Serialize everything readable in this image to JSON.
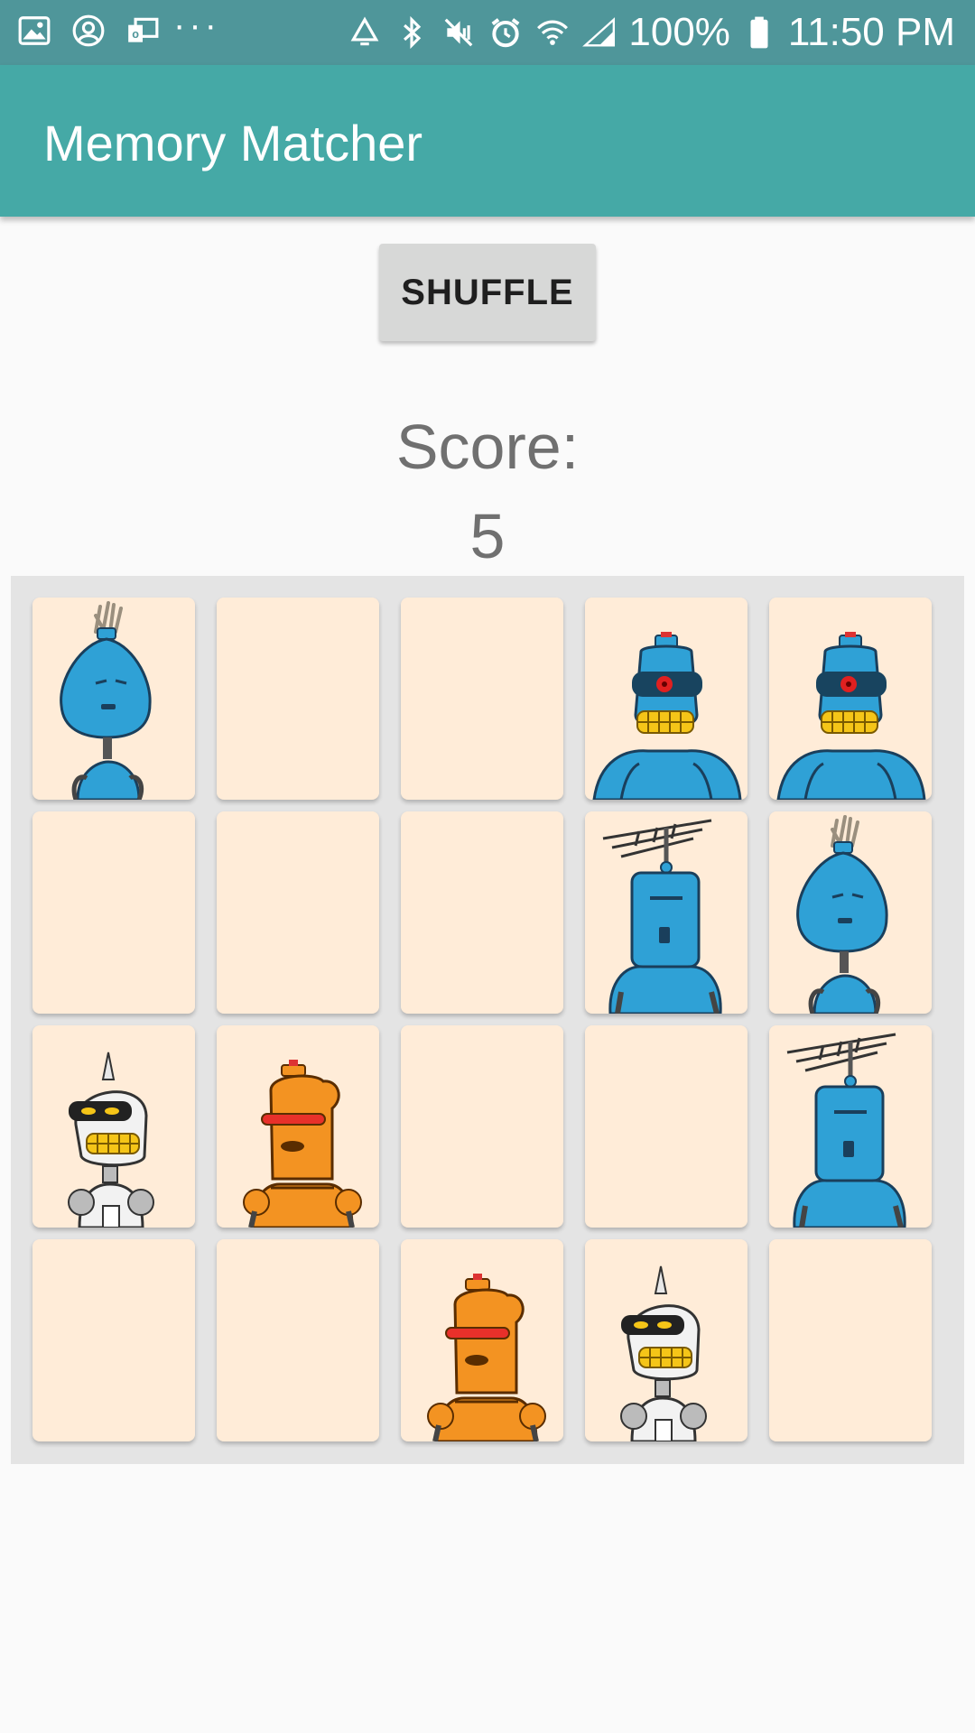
{
  "status_bar": {
    "battery": "100%",
    "time": "11:50 PM",
    "left_icons": [
      "gallery-icon",
      "account-icon",
      "email-icon",
      "more-dots-icon"
    ],
    "right_icons": [
      "recycle-icon",
      "bluetooth-icon",
      "mute-icon",
      "alarm-icon",
      "wifi-icon",
      "signal-icon",
      "battery-icon"
    ]
  },
  "app_bar": {
    "title": "Memory Matcher"
  },
  "controls": {
    "shuffle_label": "SHUFFLE"
  },
  "score": {
    "label": "Score:",
    "value": "5"
  },
  "board": {
    "rows": 4,
    "columns": 5,
    "cards": [
      {
        "face": "robot-hair"
      },
      {
        "face": "blank"
      },
      {
        "face": "blank"
      },
      {
        "face": "robot-cyclops"
      },
      {
        "face": "robot-cyclops"
      },
      {
        "face": "blank"
      },
      {
        "face": "blank"
      },
      {
        "face": "blank"
      },
      {
        "face": "robot-antenna"
      },
      {
        "face": "robot-hair"
      },
      {
        "face": "robot-silver"
      },
      {
        "face": "robot-orange"
      },
      {
        "face": "blank"
      },
      {
        "face": "blank"
      },
      {
        "face": "robot-antenna"
      },
      {
        "face": "blank"
      },
      {
        "face": "blank"
      },
      {
        "face": "robot-orange"
      },
      {
        "face": "robot-silver"
      },
      {
        "face": "blank"
      }
    ]
  },
  "colors": {
    "status_bar": "#4f969a",
    "app_bar": "#45a9a6",
    "card_face": "#ffecd8",
    "board_bg": "#e4e4e4",
    "score_text": "#707070"
  }
}
